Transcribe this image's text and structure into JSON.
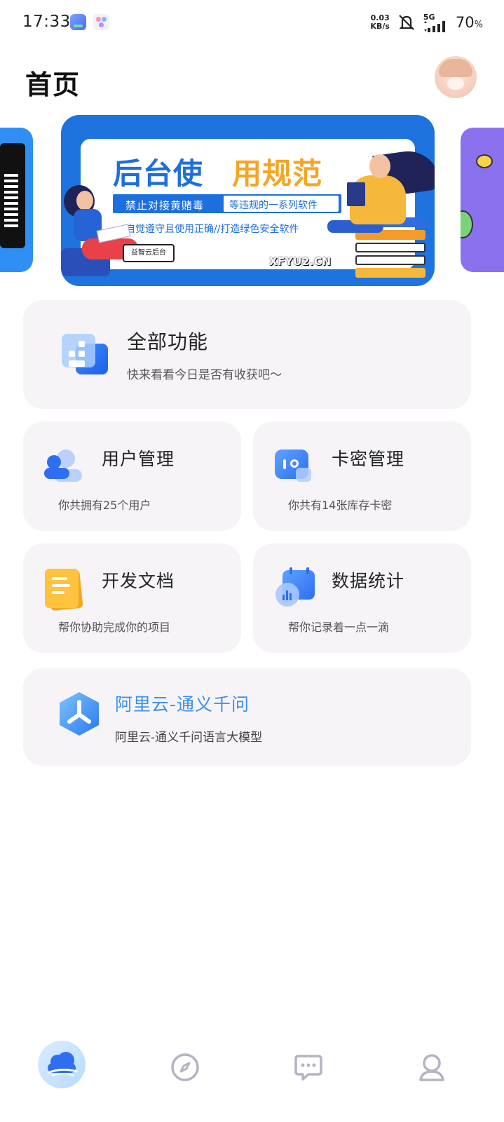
{
  "status_bar": {
    "time": "17:33",
    "net_speed_value": "0.03",
    "net_speed_unit": "KB/s",
    "network": "5G",
    "battery": "70",
    "battery_unit": "%",
    "icons": [
      "app-icon",
      "assistant-icon",
      "mute-icon",
      "signal-icon"
    ]
  },
  "header": {
    "title": "首页",
    "avatar_icon": "user-avatar"
  },
  "banner": {
    "title_part1": "后台使",
    "title_part2": "用规范",
    "bar_left": "禁止对接黄赌毒",
    "bar_right": "等违规的一系列软件",
    "subtitle": "自觉遵守且使用正确//打造绿色安全软件",
    "signature": "益智云后台",
    "watermark": "XFYU2.CN",
    "colors": {
      "background": "#1f73de",
      "title_blue": "#1d6fde",
      "title_orange": "#f5a623"
    }
  },
  "cards": {
    "all_functions": {
      "title": "全部功能",
      "subtitle": "快来看看今日是否有收获吧～",
      "icon": "apps-grid-icon"
    },
    "user_management": {
      "title": "用户管理",
      "subtitle": "你共拥有25个用户",
      "icon": "users-icon"
    },
    "card_management": {
      "title": "卡密管理",
      "subtitle": "你共有14张库存卡密",
      "icon": "card-key-icon"
    },
    "dev_docs": {
      "title": "开发文档",
      "subtitle": "帮你协助完成你的项目",
      "icon": "document-icon"
    },
    "data_stats": {
      "title": "数据统计",
      "subtitle": "帮你记录着一点一滴",
      "icon": "calendar-chart-icon"
    },
    "ai_model": {
      "title": "阿里云-通义千问",
      "subtitle": "阿里云-通义千问语言大模型",
      "icon": "tongyi-qianwen-icon",
      "title_color": "#3c8ff0"
    }
  },
  "bottom_nav": {
    "items": [
      {
        "name": "home",
        "icon": "home-cloud-icon",
        "active": true
      },
      {
        "name": "discover",
        "icon": "compass-icon",
        "active": false
      },
      {
        "name": "messages",
        "icon": "chat-icon",
        "active": false
      },
      {
        "name": "profile",
        "icon": "person-icon",
        "active": false
      }
    ]
  }
}
